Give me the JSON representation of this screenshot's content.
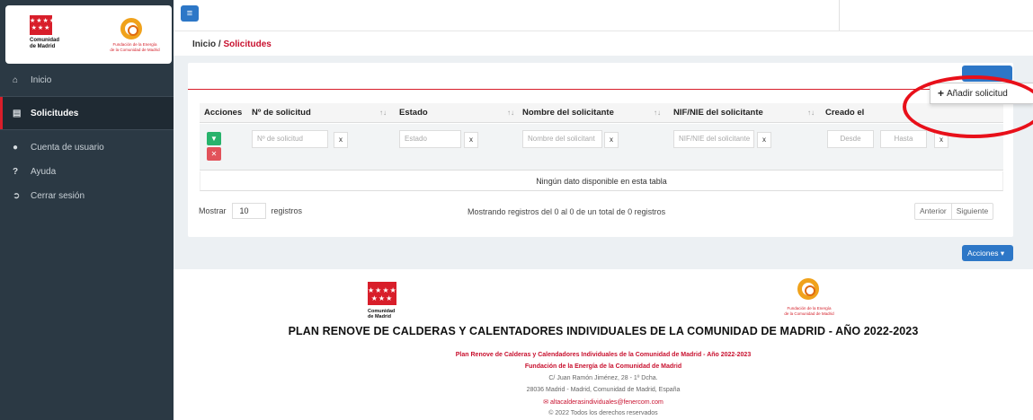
{
  "sidebar": {
    "logo_left": {
      "flag_stars": "★★★★ ★★★",
      "line1": "Comunidad",
      "line2": "de Madrid"
    },
    "logo_right": {
      "line1": "Fundación de la Energía",
      "line2": "de la Comunidad de Madrid"
    },
    "items": [
      {
        "label": "Inicio",
        "icon": "home-icon"
      },
      {
        "label": "Solicitudes",
        "icon": "list-icon",
        "active": true
      },
      {
        "label": "Cuenta de usuario",
        "icon": "user-icon"
      },
      {
        "label": "Ayuda",
        "icon": "question-icon"
      },
      {
        "label": "Cerrar sesión",
        "icon": "sign-out-icon"
      }
    ]
  },
  "header": {
    "menu_icon": "≡"
  },
  "breadcrumb": {
    "home": "Inicio",
    "separator": "/",
    "current": "Solicitudes"
  },
  "actions_menu": {
    "add_label": "Añadir solicitud",
    "bottom_button": "Acciones"
  },
  "table": {
    "columns": [
      "Acciones",
      "Nº de solicitud",
      "Estado",
      "Nombre del solicitante",
      "NIF/NIE del solicitante",
      "Creado el"
    ],
    "filters": {
      "num_placeholder": "Nº de solicitud",
      "estado_placeholder": "Estado",
      "nombre_placeholder": "Nombre del solicitant",
      "nif_placeholder": "NIF/NIE del solicitante",
      "desde_placeholder": "Desde",
      "hasta_placeholder": "Hasta",
      "clear": "x"
    },
    "empty_message": "Ningún dato disponible en esta tabla"
  },
  "pagination": {
    "show_label": "Mostrar",
    "page_size": "10",
    "records_label": "registros",
    "info": "Mostrando registros del 0 al 0 de un total de 0 registros",
    "prev": "Anterior",
    "next": "Siguiente"
  },
  "footer": {
    "title": "PLAN RENOVE DE CALDERAS Y CALENTADORES INDIVIDUALES DE LA COMUNIDAD DE MADRID - AÑO 2022-2023",
    "program": "Plan Renove de Calderas y Calendadores Individuales de la Comunidad de Madrid - Año 2022-2023",
    "org": "Fundación de la Energía de la Comunidad de Madrid",
    "address1": "C/ Juan Ramón Jiménez, 28 - 1º Dcha.",
    "address2": "28036 Madrid - Madrid, Comunidad de Madrid, España",
    "email": "altacalderasindividuales@fenercom.com",
    "copyright": "© 2022 Todos los derechos reservados"
  },
  "colors": {
    "sidebar": "#2b3944",
    "accent_red": "#d81e2a",
    "primary_blue": "#2d77c7",
    "success_green": "#28b36c"
  }
}
